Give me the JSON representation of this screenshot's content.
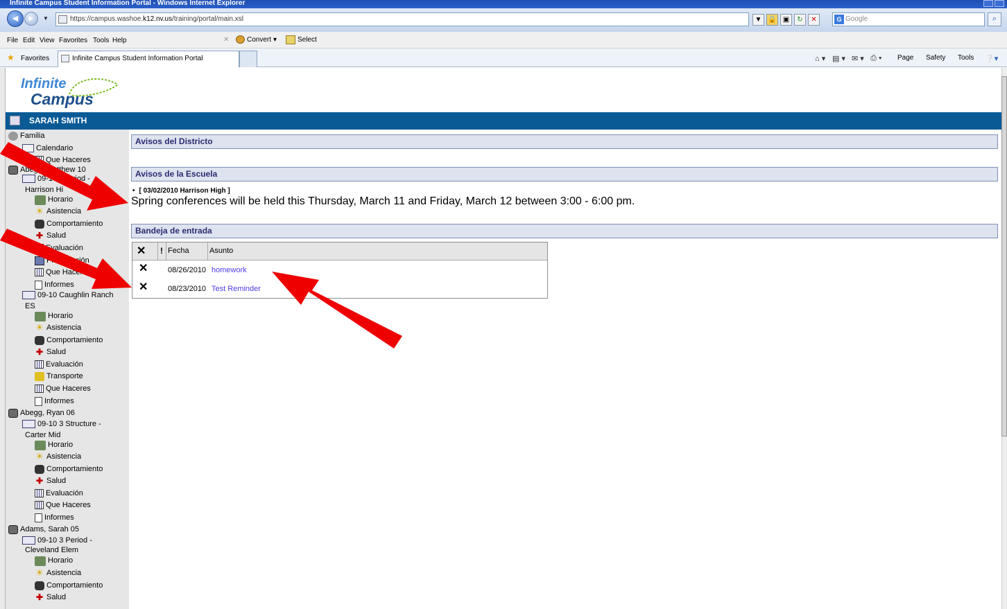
{
  "browser": {
    "title": "Infinite Campus Student Information Portal - Windows Internet Explorer",
    "url_prefix": "https://campus.washoe.",
    "url_domain": "k12.nv.us",
    "url_path": "/training/portal/main.xsl",
    "search_placeholder": "Google",
    "menu": [
      "File",
      "Edit",
      "View",
      "Favorites",
      "Tools",
      "Help"
    ],
    "convert_label": "Convert",
    "select_label": "Select",
    "favorites_label": "Favorites",
    "tab_title": "Infinite Campus Student Information Portal",
    "commands": [
      "Page",
      "Safety",
      "Tools"
    ]
  },
  "logo": {
    "line1": "Infinite",
    "line2": "Campus"
  },
  "user": {
    "name": "SARAH SMITH"
  },
  "sidebar": {
    "items": [
      {
        "label": "Familia",
        "icon": "family-icon"
      },
      {
        "label": "Calendario",
        "icon": "calendar-icon"
      },
      {
        "label": "Que Haceres",
        "icon": "grid-icon"
      },
      {
        "label": "Abegg, Matthew 10",
        "icon": "student-icon"
      },
      {
        "label": "09-10 4Period -",
        "icon": "school-icon"
      },
      {
        "label": "Harrison Hi",
        "icon": ""
      },
      {
        "label": "Horario",
        "icon": "schedule-icon"
      },
      {
        "label": "Asistencia",
        "icon": "attendance-icon"
      },
      {
        "label": "Comportamiento",
        "icon": "behavior-icon"
      },
      {
        "label": "Salud",
        "icon": "health-icon"
      },
      {
        "label": "Evaluación",
        "icon": "grid-icon"
      },
      {
        "label": "Planificación",
        "icon": "planner-icon"
      },
      {
        "label": "Que Haceres",
        "icon": "grid-icon"
      },
      {
        "label": "Informes",
        "icon": "document-icon"
      },
      {
        "label": "09-10 Caughlin Ranch",
        "icon": "school-icon"
      },
      {
        "label": "ES",
        "icon": ""
      },
      {
        "label": "Horario",
        "icon": "schedule-icon"
      },
      {
        "label": "Asistencia",
        "icon": "attendance-icon"
      },
      {
        "label": "Comportamiento",
        "icon": "behavior-icon"
      },
      {
        "label": "Salud",
        "icon": "health-icon"
      },
      {
        "label": "Evaluación",
        "icon": "grid-icon"
      },
      {
        "label": "Transporte",
        "icon": "bus-icon"
      },
      {
        "label": "Que Haceres",
        "icon": "grid-icon"
      },
      {
        "label": "Informes",
        "icon": "document-icon"
      },
      {
        "label": "Abegg, Ryan 06",
        "icon": "student-icon"
      },
      {
        "label": "09-10 3 Structure -",
        "icon": "school-icon"
      },
      {
        "label": "Carter Mid",
        "icon": ""
      },
      {
        "label": "Horario",
        "icon": "schedule-icon"
      },
      {
        "label": "Asistencia",
        "icon": "attendance-icon"
      },
      {
        "label": "Comportamiento",
        "icon": "behavior-icon"
      },
      {
        "label": "Salud",
        "icon": "health-icon"
      },
      {
        "label": "Evaluación",
        "icon": "grid-icon"
      },
      {
        "label": "Que Haceres",
        "icon": "grid-icon"
      },
      {
        "label": "Informes",
        "icon": "document-icon"
      },
      {
        "label": "Adams, Sarah 05",
        "icon": "student-icon"
      },
      {
        "label": "09-10 3 Period -",
        "icon": "school-icon"
      },
      {
        "label": "Cleveland Elem",
        "icon": ""
      },
      {
        "label": "Horario",
        "icon": "schedule-icon"
      },
      {
        "label": "Asistencia",
        "icon": "attendance-icon"
      },
      {
        "label": "Comportamiento",
        "icon": "behavior-icon"
      },
      {
        "label": "Salud",
        "icon": "health-icon"
      }
    ]
  },
  "district_notices": {
    "title": "Avisos del Districto"
  },
  "school_notices": {
    "title": "Avisos de la Escuela",
    "items": [
      {
        "header": "[ 03/02/2010 Harrison High ]",
        "message": "Spring conferences will be held this Thursday, March 11 and Friday, March 12 between 3:00 - 6:00 pm."
      }
    ]
  },
  "inbox": {
    "title": "Bandeja de entrada",
    "columns": {
      "delete": "✕",
      "priority": "!",
      "date": "Fecha",
      "subject": "Asunto"
    },
    "rows": [
      {
        "date": "08/26/2010",
        "subject": "homework"
      },
      {
        "date": "08/23/2010",
        "subject": "Test Reminder"
      }
    ]
  },
  "colors": {
    "header_blue": "#0a5a96",
    "link": "#4f3ce6",
    "arrow": "#ee0000"
  }
}
